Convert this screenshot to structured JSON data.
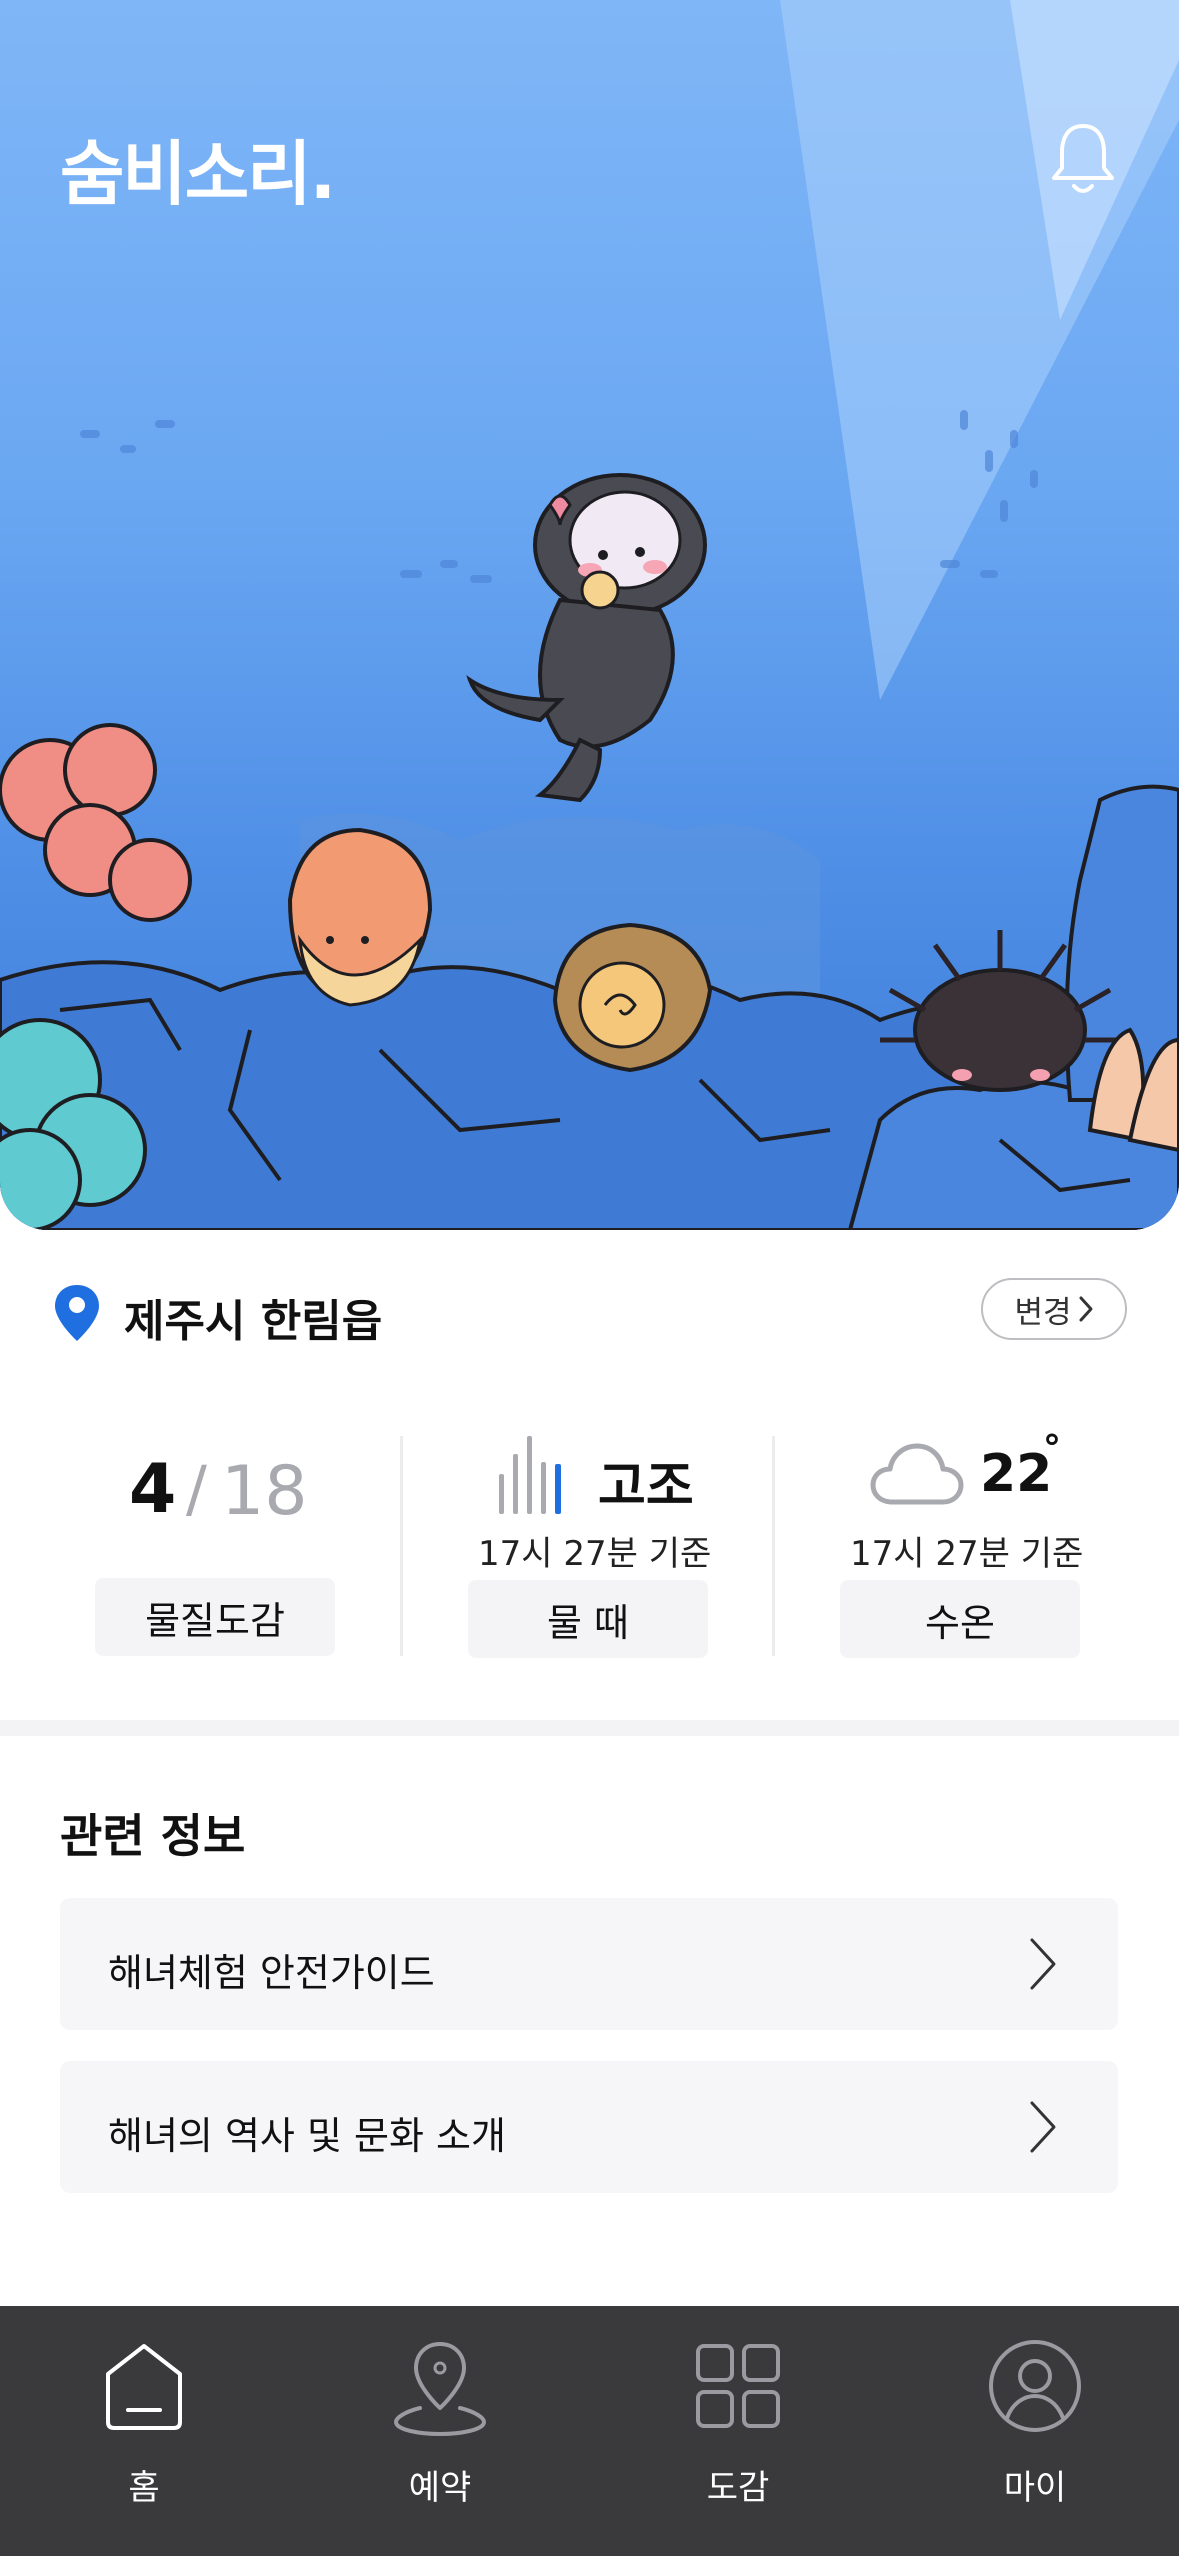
{
  "app": {
    "logo_text": "숨비소리."
  },
  "location": {
    "name": "제주시 한림읍",
    "change_label": "변경"
  },
  "stats": {
    "collection": {
      "count": "4",
      "separator": "/",
      "total": "18",
      "label": "물질도감"
    },
    "tide": {
      "value": "고조",
      "time": "17시 27분 기준",
      "label": "물 때"
    },
    "water_temp": {
      "value": "22",
      "unit": "°",
      "time": "17시 27분 기준",
      "label": "수온"
    }
  },
  "related": {
    "title": "관련 정보",
    "items": [
      {
        "label": "해녀체험 안전가이드"
      },
      {
        "label": "해녀의 역사 및 문화 소개"
      }
    ]
  },
  "tabbar": {
    "tabs": [
      {
        "label": "홈",
        "icon": "home-icon"
      },
      {
        "label": "예약",
        "icon": "map-pin-icon"
      },
      {
        "label": "도감",
        "icon": "grid-icon"
      },
      {
        "label": "마이",
        "icon": "profile-icon"
      }
    ]
  },
  "colors": {
    "accent": "#1f6fe0",
    "tabbar_bg": "#3a3a3c",
    "pill_bg": "#f4f4f6"
  }
}
